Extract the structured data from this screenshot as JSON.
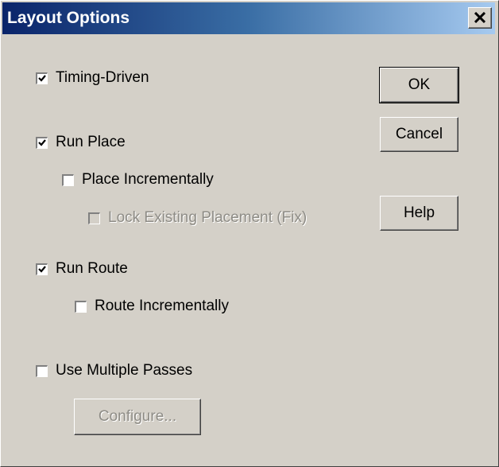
{
  "window": {
    "title": "Layout Options"
  },
  "options": {
    "timing_driven": {
      "label": "Timing-Driven",
      "checked": true,
      "enabled": true
    },
    "run_place": {
      "label": "Run Place",
      "checked": true,
      "enabled": true
    },
    "place_incrementally": {
      "label": "Place Incrementally",
      "checked": false,
      "enabled": true
    },
    "lock_existing_placement": {
      "label": "Lock Existing Placement (Fix)",
      "checked": false,
      "enabled": false
    },
    "run_route": {
      "label": "Run Route",
      "checked": true,
      "enabled": true
    },
    "route_incrementally": {
      "label": "Route Incrementally",
      "checked": false,
      "enabled": true
    },
    "use_multiple_passes": {
      "label": "Use Multiple Passes",
      "checked": false,
      "enabled": true
    }
  },
  "buttons": {
    "ok": "OK",
    "cancel": "Cancel",
    "help": "Help",
    "configure": "Configure..."
  },
  "icons": {
    "close": "close-icon",
    "check": "checkmark-icon"
  }
}
